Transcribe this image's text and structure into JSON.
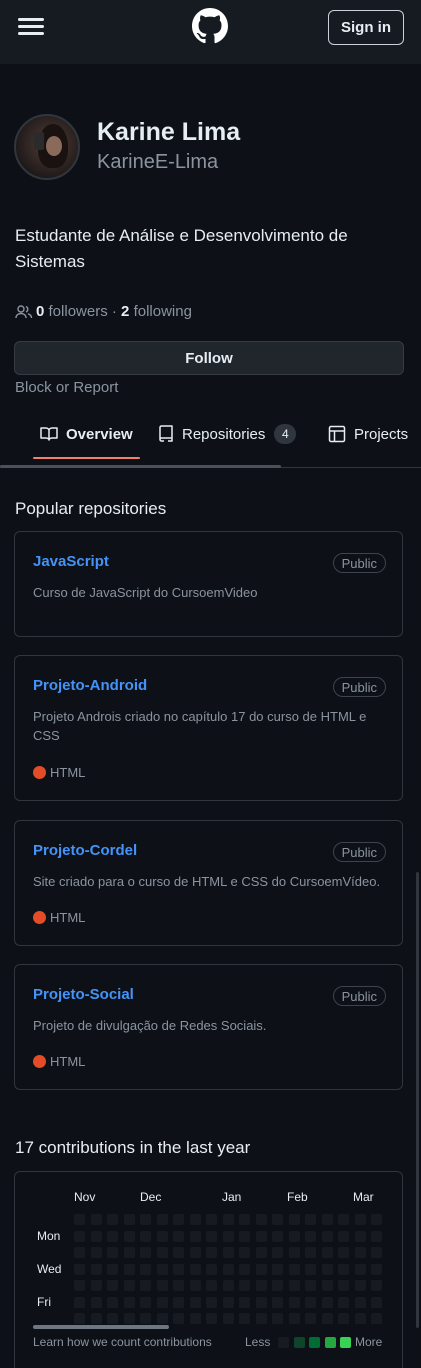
{
  "header": {
    "menu_icon": "hamburger-icon",
    "logo_icon": "github-mark-icon",
    "signin_label": "Sign in"
  },
  "profile": {
    "avatar_icon": "avatar",
    "name": "Karine Lima",
    "login": "KarineE-Lima",
    "bio": "Estudante de Análise e Desenvolvimento de Sistemas",
    "followers_count": "0",
    "followers_label": "followers",
    "separator": "·",
    "following_count": "2",
    "following_label": "following",
    "follow_button": "Follow",
    "block_label": "Block or Report"
  },
  "tabs": [
    {
      "label": "Overview",
      "icon": "book-icon",
      "selected": true
    },
    {
      "label": "Repositories",
      "icon": "repo-icon",
      "count": "4"
    },
    {
      "label": "Projects",
      "icon": "table-icon"
    }
  ],
  "popular": {
    "title": "Popular repositories",
    "repos": [
      {
        "name": "JavaScript",
        "visibility": "Public",
        "description": "Curso de JavaScript do CursoemVideo"
      },
      {
        "name": "Projeto-Android",
        "visibility": "Public",
        "description": "Projeto Androis criado no capítulo 17 do curso de HTML e CSS",
        "language": "HTML"
      },
      {
        "name": "Projeto-Cordel",
        "visibility": "Public",
        "description": "Site criado para o curso de HTML e CSS do CursoemVídeo.",
        "language": "HTML"
      },
      {
        "name": "Projeto-Social",
        "visibility": "Public",
        "description": "Projeto de divulgação de Redes Sociais.",
        "language": "HTML"
      }
    ]
  },
  "contributions": {
    "title": "17 contributions in the last year",
    "months": [
      "Nov",
      "Dec",
      "Jan",
      "Feb",
      "Mar"
    ],
    "weekdays": [
      "Mon",
      "Wed",
      "Fri"
    ],
    "learn_link": "Learn how we count contributions",
    "legend_less": "Less",
    "legend_more": "More"
  },
  "colors": {
    "background": "#0d1117",
    "link": "#4493f8",
    "html_language": "#e34c26",
    "tab_underline": "#f78166",
    "empty_cell": "#161b22",
    "legend_levels": [
      "#161b22",
      "#0e4429",
      "#006d32",
      "#26a641",
      "#39d353"
    ]
  }
}
